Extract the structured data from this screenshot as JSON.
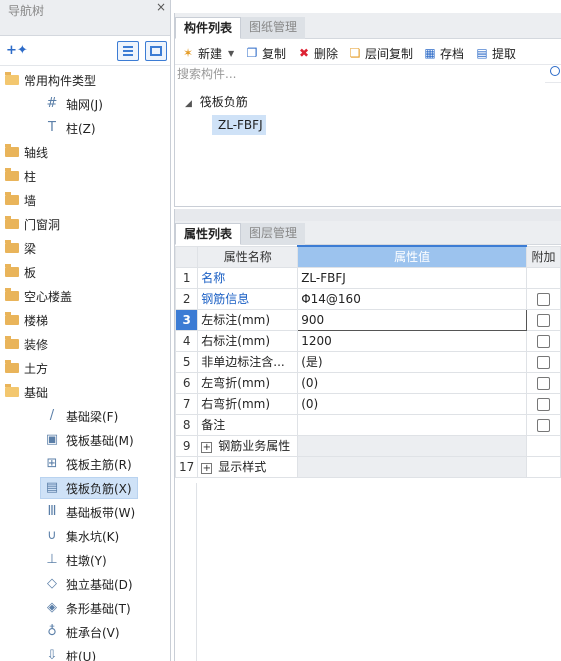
{
  "nav": {
    "title": "导航树",
    "close": "×",
    "tree": [
      {
        "label": "常用构件类型",
        "open": true
      },
      {
        "label": "轴网(J)",
        "child": true,
        "icon": "#"
      },
      {
        "label": "柱(Z)",
        "child": true,
        "icon": "T"
      },
      {
        "label": "轴线"
      },
      {
        "label": "柱"
      },
      {
        "label": "墙"
      },
      {
        "label": "门窗洞"
      },
      {
        "label": "梁"
      },
      {
        "label": "板"
      },
      {
        "label": "空心楼盖"
      },
      {
        "label": "楼梯"
      },
      {
        "label": "装修"
      },
      {
        "label": "土方"
      },
      {
        "label": "基础",
        "open": true
      },
      {
        "label": "基础梁(F)",
        "child": true,
        "icon": "/"
      },
      {
        "label": "筏板基础(M)",
        "child": true,
        "icon": "▣"
      },
      {
        "label": "筏板主筋(R)",
        "child": true,
        "icon": "⊞"
      },
      {
        "label": "筏板负筋(X)",
        "child": true,
        "icon": "▤",
        "selected": true
      },
      {
        "label": "基础板带(W)",
        "child": true,
        "icon": "Ⅲ"
      },
      {
        "label": "集水坑(K)",
        "child": true,
        "icon": "∪"
      },
      {
        "label": "柱墩(Y)",
        "child": true,
        "icon": "⊥"
      },
      {
        "label": "独立基础(D)",
        "child": true,
        "icon": "◇"
      },
      {
        "label": "条形基础(T)",
        "child": true,
        "icon": "◈"
      },
      {
        "label": "桩承台(V)",
        "child": true,
        "icon": "♁"
      },
      {
        "label": "桩(U)",
        "child": true,
        "icon": "⇩"
      }
    ]
  },
  "components": {
    "tabs": [
      "构件列表",
      "图纸管理"
    ],
    "toolbar": {
      "new": "新建",
      "copy": "复制",
      "delete": "删除",
      "layer_copy": "层间复制",
      "save": "存档",
      "extract": "提取"
    },
    "search_placeholder": "搜索构件...",
    "group": "筏板负筋",
    "item": "ZL-FBFJ"
  },
  "properties": {
    "tabs": [
      "属性列表",
      "图层管理"
    ],
    "headers": {
      "name": "属性名称",
      "value": "属性值",
      "extra": "附加"
    },
    "rows": [
      {
        "num": "1",
        "name": "名称",
        "value": "ZL-FBFJ",
        "blue": true,
        "checkbox": false
      },
      {
        "num": "2",
        "name": "钢筋信息",
        "value": "Φ14@160",
        "blue": true,
        "checkbox": true
      },
      {
        "num": "3",
        "name": "左标注(mm)",
        "value": "900",
        "checkbox": true,
        "selected": true
      },
      {
        "num": "4",
        "name": "右标注(mm)",
        "value": "1200",
        "checkbox": true
      },
      {
        "num": "5",
        "name": "非单边标注含...",
        "value": "(是)",
        "checkbox": true
      },
      {
        "num": "6",
        "name": "左弯折(mm)",
        "value": "(0)",
        "checkbox": true
      },
      {
        "num": "7",
        "name": "右弯折(mm)",
        "value": "(0)",
        "checkbox": true
      },
      {
        "num": "8",
        "name": "备注",
        "value": "",
        "checkbox": true
      },
      {
        "num": "9",
        "name": "钢筋业务属性",
        "value": "",
        "group": true
      },
      {
        "num": "17",
        "name": "显示样式",
        "value": "",
        "group": true
      }
    ]
  }
}
